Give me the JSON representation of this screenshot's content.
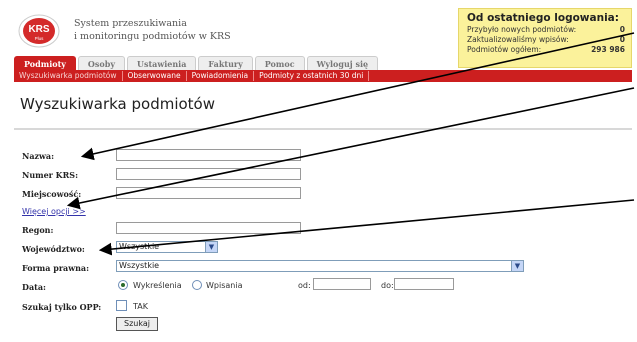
{
  "logo": {
    "text": "KRS",
    "sub": "Plus"
  },
  "brand": {
    "line1": "System przeszukiwania",
    "line2": "i monitoringu podmiotów w KRS"
  },
  "info": {
    "title": "Od ostatniego logowania:",
    "rows": [
      {
        "label": "Przybyło nowych podmiotów:",
        "value": "0"
      },
      {
        "label": "Zaktualizowaliśmy wpisów:",
        "value": "0"
      },
      {
        "label": "Podmiotów ogółem:",
        "value": "293 986"
      }
    ]
  },
  "tabs": [
    "Podmioty",
    "Osoby",
    "Ustawienia",
    "Faktury",
    "Pomoc",
    "Wyloguj się"
  ],
  "subnav": [
    "Wyszukiwarka podmiotów",
    "Obserwowane",
    "Powiadomienia",
    "Podmioty z ostatnich 30 dni"
  ],
  "page_title": "Wyszukiwarka podmiotów",
  "form": {
    "nazwa": "Nazwa:",
    "krs": "Numer KRS:",
    "miejscowosc": "Miejscowość:",
    "more": "Więcej opcji >>",
    "regon": "Regon:",
    "woj": "Województwo:",
    "woj_value": "Wszystkie",
    "forma": "Forma prawna:",
    "forma_value": "Wszystkie",
    "data": "Data:",
    "radio1": "Wykreślenia",
    "radio2": "Wpisania",
    "od": "od:",
    "do": "do:",
    "opp": "Szukaj tylko OPP:",
    "opp_tak": "TAK",
    "submit": "Szukaj"
  },
  "colors": {
    "accent": "#cc1f1f",
    "info_bg": "#fbf29b"
  }
}
